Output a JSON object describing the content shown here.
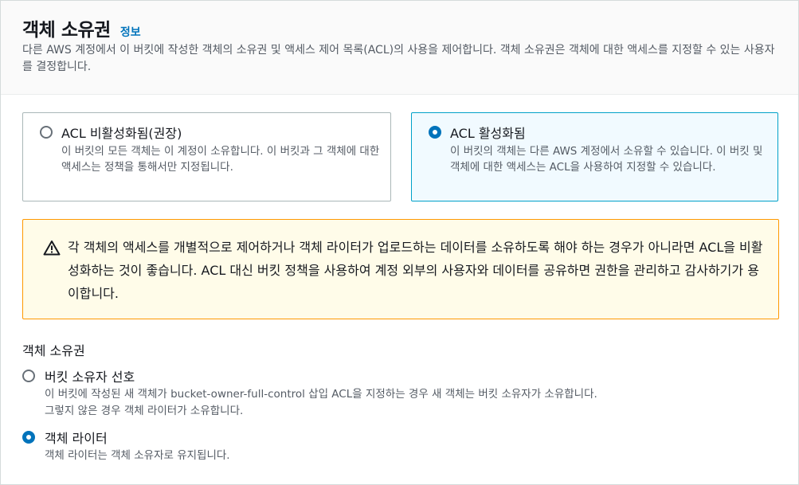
{
  "header": {
    "title": "객체 소유권",
    "info_link": "정보",
    "description": "다른 AWS 계정에서 이 버킷에 작성한 객체의 소유권 및 액세스 제어 목록(ACL)의 사용을 제어합니다. 객체 소유권은 객체에 대한 액세스를 지정할 수 있는 사용자를 결정합니다."
  },
  "acl_options": [
    {
      "label": "ACL 비활성화됨(권장)",
      "description": "이 버킷의 모든 객체는 이 계정이 소유합니다. 이 버킷과 그 객체에 대한 액세스는 정책을 통해서만 지정됩니다.",
      "selected": false
    },
    {
      "label": "ACL 활성화됨",
      "description": "이 버킷의 객체는 다른 AWS 계정에서 소유할 수 있습니다. 이 버킷 및 객체에 대한 액세스는 ACL을 사용하여 지정할 수 있습니다.",
      "selected": true
    }
  ],
  "warning": {
    "icon": "warning-triangle-icon",
    "text": "각 객체의 액세스를 개별적으로 제어하거나 객체 라이터가 업로드하는 데이터를 소유하도록 해야 하는 경우가 아니라면 ACL을 비활성화하는 것이 좋습니다. ACL 대신 버킷 정책을 사용하여 계정 외부의 사용자와 데이터를 공유하면 권한을 관리하고 감사하기가 용이합니다."
  },
  "ownership": {
    "label": "객체 소유권",
    "options": [
      {
        "label": "버킷 소유자 선호",
        "description": "이 버킷에 작성된 새 객체가 bucket-owner-full-control 삽입 ACL을 지정하는 경우 새 객체는 버킷 소유자가 소유합니다. 그렇지 않은 경우 객체 라이터가 소유합니다.",
        "selected": false
      },
      {
        "label": "객체 라이터",
        "description": "객체 라이터는 객체 소유자로 유지됩니다.",
        "selected": true
      }
    ]
  },
  "colors": {
    "accent": "#0073bb",
    "warning_bg": "#fffce9",
    "warning_border": "#ff9900",
    "selected_card_bg": "#f1faff"
  }
}
